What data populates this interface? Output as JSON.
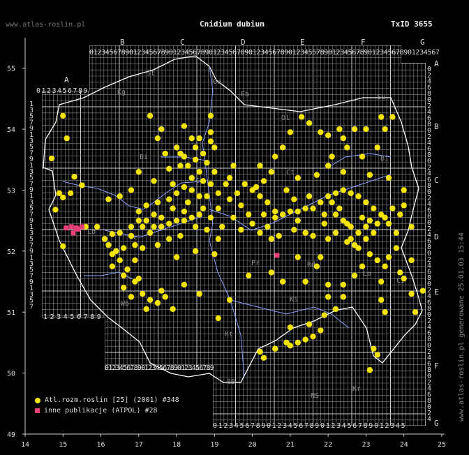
{
  "header": {
    "title": "Cnidium dubium",
    "txid": "TxID 3655",
    "site_top": "www.atlas-roslin.pl",
    "site_side": "www.atlas-roslin.pl generowane 25.01.03 15:44"
  },
  "axes": {
    "x_ticks": [
      "14",
      "15",
      "16",
      "17",
      "18",
      "19",
      "20",
      "21",
      "22",
      "23",
      "24",
      "25"
    ],
    "y_ticks": [
      "55",
      "54",
      "53",
      "52",
      "51",
      "50",
      "49"
    ]
  },
  "atpol": {
    "column_letters": [
      "A",
      "B",
      "C",
      "D",
      "E",
      "F",
      "G"
    ],
    "row_letters": [
      "A",
      "B",
      "C",
      "D",
      "E",
      "F",
      "G"
    ],
    "digits": "0123456789",
    "cells": [
      "St",
      "Kg",
      "Ga",
      "Eb",
      "Su",
      "Ol",
      "Bi",
      "Bi",
      "Ct",
      "Ce",
      "Le",
      "Lo",
      "Pr",
      "Rd",
      "Lb",
      "Ci",
      "Wb",
      "Ki",
      "Kt",
      "BB",
      "NS",
      "Kr"
    ]
  },
  "legend": {
    "items": [
      {
        "label": "Atl.rozm.roslin [25] (2001) #348",
        "color": "#f5e400",
        "shape": "circle"
      },
      {
        "label": "inne publikacje (ATPOL) #28",
        "color": "#e8417a",
        "shape": "square"
      }
    ]
  },
  "colors": {
    "background": "#000000",
    "grid": "#9a9a9a",
    "river": "#8aa0ff",
    "border": "#ffffff",
    "yellow": "#f5e400",
    "pink": "#e8417a"
  },
  "chart_data": {
    "type": "scatter",
    "xlabel": "",
    "ylabel": "",
    "xlim": [
      14,
      25
    ],
    "ylim": [
      49,
      55.5
    ],
    "series": [
      {
        "name": "Atl.rozm.roslin [25] (2001) #348",
        "color": "#f5e400",
        "points": [
          [
            15.0,
            54.22
          ],
          [
            15.1,
            53.85
          ],
          [
            14.7,
            53.52
          ],
          [
            15.3,
            53.22
          ],
          [
            15.5,
            53.08
          ],
          [
            14.9,
            52.95
          ],
          [
            15.0,
            52.88
          ],
          [
            15.2,
            52.95
          ],
          [
            14.8,
            52.68
          ],
          [
            15.0,
            52.08
          ],
          [
            16.1,
            52.2
          ],
          [
            16.3,
            52.28
          ],
          [
            16.2,
            52.1
          ],
          [
            16.5,
            52.3
          ],
          [
            16.8,
            52.4
          ],
          [
            17.0,
            52.5
          ],
          [
            17.2,
            52.5
          ],
          [
            17.1,
            52.4
          ],
          [
            17.4,
            52.4
          ],
          [
            17.6,
            52.4
          ],
          [
            17.8,
            52.45
          ],
          [
            18.0,
            52.5
          ],
          [
            18.2,
            52.5
          ],
          [
            18.4,
            52.55
          ],
          [
            18.6,
            52.6
          ],
          [
            17.0,
            52.65
          ],
          [
            17.2,
            52.75
          ],
          [
            17.5,
            52.8
          ],
          [
            17.8,
            52.85
          ],
          [
            18.0,
            52.95
          ],
          [
            18.2,
            53.05
          ],
          [
            18.4,
            53.2
          ],
          [
            18.3,
            53.4
          ],
          [
            18.5,
            53.5
          ],
          [
            18.7,
            53.6
          ],
          [
            18.5,
            53.7
          ],
          [
            18.6,
            53.85
          ],
          [
            18.9,
            53.8
          ],
          [
            18.2,
            54.05
          ],
          [
            18.0,
            53.7
          ],
          [
            17.7,
            53.6
          ],
          [
            17.5,
            53.85
          ],
          [
            17.3,
            54.22
          ],
          [
            17.6,
            54.0
          ],
          [
            18.9,
            54.22
          ],
          [
            18.9,
            53.95
          ],
          [
            18.8,
            52.9
          ],
          [
            19.1,
            52.95
          ],
          [
            19.3,
            53.1
          ],
          [
            19.1,
            52.7
          ],
          [
            19.4,
            52.85
          ],
          [
            19.6,
            52.95
          ],
          [
            19.8,
            53.1
          ],
          [
            20.0,
            53.0
          ],
          [
            20.2,
            52.9
          ],
          [
            20.4,
            52.8
          ],
          [
            20.6,
            52.65
          ],
          [
            20.8,
            52.6
          ],
          [
            21.0,
            52.65
          ],
          [
            21.2,
            52.65
          ],
          [
            21.4,
            52.7
          ],
          [
            21.6,
            52.7
          ],
          [
            21.8,
            52.8
          ],
          [
            22.0,
            52.9
          ],
          [
            22.2,
            52.95
          ],
          [
            22.4,
            53.0
          ],
          [
            22.6,
            52.95
          ],
          [
            22.8,
            52.9
          ],
          [
            23.0,
            52.8
          ],
          [
            23.2,
            52.7
          ],
          [
            23.4,
            52.6
          ],
          [
            23.6,
            52.45
          ],
          [
            23.8,
            52.3
          ],
          [
            22.2,
            52.6
          ],
          [
            22.4,
            52.5
          ],
          [
            22.6,
            52.4
          ],
          [
            22.8,
            52.3
          ],
          [
            23.0,
            52.2
          ],
          [
            23.2,
            52.3
          ],
          [
            22.0,
            52.2
          ],
          [
            22.2,
            52.3
          ],
          [
            21.6,
            52.25
          ],
          [
            21.4,
            52.3
          ],
          [
            21.2,
            52.5
          ],
          [
            20.6,
            52.55
          ],
          [
            20.4,
            52.4
          ],
          [
            20.2,
            52.3
          ],
          [
            20.5,
            52.2
          ],
          [
            16.5,
            51.85
          ],
          [
            16.7,
            51.7
          ],
          [
            16.9,
            51.5
          ],
          [
            17.1,
            51.3
          ],
          [
            17.3,
            51.2
          ],
          [
            17.5,
            51.15
          ],
          [
            17.7,
            51.25
          ],
          [
            17.2,
            51.05
          ],
          [
            16.9,
            51.85
          ],
          [
            16.6,
            51.6
          ],
          [
            19.4,
            51.2
          ],
          [
            19.1,
            50.9
          ],
          [
            20.2,
            50.35
          ],
          [
            20.3,
            50.25
          ],
          [
            20.6,
            50.4
          ],
          [
            20.9,
            50.5
          ],
          [
            21.0,
            50.45
          ],
          [
            21.2,
            50.5
          ],
          [
            21.4,
            50.55
          ],
          [
            21.6,
            50.6
          ],
          [
            21.8,
            50.7
          ],
          [
            21.5,
            50.8
          ],
          [
            21.0,
            50.75
          ],
          [
            21.9,
            50.95
          ],
          [
            22.0,
            51.25
          ],
          [
            22.4,
            51.45
          ],
          [
            22.7,
            51.6
          ],
          [
            22.9,
            51.75
          ],
          [
            23.3,
            51.85
          ],
          [
            23.6,
            51.9
          ],
          [
            23.9,
            51.65
          ],
          [
            23.4,
            51.5
          ],
          [
            23.5,
            51.0
          ],
          [
            23.4,
            51.2
          ],
          [
            24.2,
            51.3
          ],
          [
            24.3,
            51.0
          ],
          [
            24.0,
            51.55
          ],
          [
            23.1,
            50.05
          ],
          [
            23.2,
            50.4
          ],
          [
            23.3,
            50.3
          ],
          [
            22.5,
            53.7
          ],
          [
            22.9,
            53.55
          ],
          [
            23.3,
            53.7
          ],
          [
            23.5,
            54.0
          ],
          [
            23.7,
            54.2
          ],
          [
            23.4,
            54.2
          ],
          [
            23.0,
            54.0
          ],
          [
            22.7,
            54.0
          ],
          [
            22.3,
            54.0
          ],
          [
            22.0,
            53.9
          ],
          [
            21.8,
            53.95
          ],
          [
            21.5,
            54.1
          ],
          [
            21.3,
            54.2
          ],
          [
            21.0,
            53.95
          ],
          [
            20.5,
            53.3
          ],
          [
            20.2,
            53.4
          ],
          [
            21.2,
            53.2
          ],
          [
            21.7,
            53.25
          ],
          [
            22.0,
            53.4
          ],
          [
            22.4,
            53.3
          ],
          [
            23.1,
            53.25
          ],
          [
            23.6,
            53.2
          ],
          [
            24.0,
            53.0
          ],
          [
            24.0,
            52.75
          ],
          [
            23.9,
            52.6
          ],
          [
            19.9,
            52.6
          ],
          [
            19.5,
            52.55
          ],
          [
            19.2,
            52.4
          ],
          [
            19.1,
            52.2
          ],
          [
            17.5,
            52.1
          ],
          [
            17.1,
            52.05
          ],
          [
            16.6,
            52.05
          ],
          [
            16.4,
            52.0
          ],
          [
            16.3,
            51.95
          ],
          [
            18.0,
            51.9
          ],
          [
            18.5,
            52.0
          ],
          [
            19.0,
            51.95
          ],
          [
            21.2,
            51.9
          ],
          [
            21.8,
            51.9
          ],
          [
            22.5,
            52.15
          ],
          [
            22.7,
            52.1
          ],
          [
            23.1,
            51.95
          ],
          [
            23.5,
            51.75
          ],
          [
            24.2,
            51.85
          ],
          [
            24.5,
            51.35
          ],
          [
            18.1,
            53.4
          ],
          [
            17.9,
            53.1
          ],
          [
            17.8,
            53.35
          ],
          [
            18.3,
            52.8
          ],
          [
            17.4,
            53.15
          ],
          [
            17.0,
            53.3
          ],
          [
            16.8,
            53.0
          ],
          [
            16.5,
            52.9
          ],
          [
            16.2,
            52.85
          ],
          [
            15.6,
            52.4
          ],
          [
            15.9,
            52.4
          ],
          [
            16.3,
            51.75
          ],
          [
            16.6,
            51.4
          ],
          [
            16.8,
            51.25
          ],
          [
            17.0,
            51.55
          ],
          [
            17.6,
            51.35
          ],
          [
            17.9,
            51.05
          ],
          [
            18.2,
            51.45
          ],
          [
            18.6,
            51.3
          ],
          [
            19.9,
            51.6
          ],
          [
            20.5,
            51.65
          ],
          [
            20.8,
            51.5
          ],
          [
            21.4,
            51.5
          ],
          [
            22.0,
            51.45
          ],
          [
            22.2,
            51.05
          ],
          [
            22.4,
            51.25
          ],
          [
            21.7,
            51.75
          ],
          [
            23.8,
            52.05
          ],
          [
            24.2,
            52.4
          ],
          [
            22.4,
            53.85
          ],
          [
            22.1,
            53.55
          ],
          [
            20.8,
            53.7
          ],
          [
            20.6,
            53.55
          ],
          [
            19.5,
            53.4
          ],
          [
            19.0,
            53.3
          ],
          [
            18.7,
            53.15
          ],
          [
            18.6,
            52.9
          ],
          [
            18.9,
            53.1
          ],
          [
            19.4,
            53.2
          ],
          [
            20.1,
            53.05
          ],
          [
            20.3,
            53.15
          ],
          [
            20.9,
            53.0
          ],
          [
            21.1,
            52.85
          ],
          [
            21.5,
            52.9
          ],
          [
            21.9,
            52.6
          ],
          [
            22.1,
            52.8
          ],
          [
            22.3,
            52.7
          ],
          [
            22.9,
            52.55
          ],
          [
            23.1,
            52.5
          ],
          [
            23.3,
            52.45
          ],
          [
            23.5,
            52.55
          ],
          [
            23.7,
            52.7
          ],
          [
            22.6,
            52.2
          ],
          [
            22.8,
            52.05
          ],
          [
            23.0,
            52.4
          ],
          [
            22.5,
            52.45
          ],
          [
            21.9,
            52.45
          ],
          [
            21.1,
            52.35
          ],
          [
            20.7,
            52.25
          ],
          [
            20.0,
            52.45
          ],
          [
            19.7,
            52.35
          ],
          [
            18.8,
            52.35
          ],
          [
            18.5,
            52.4
          ],
          [
            18.1,
            52.25
          ],
          [
            17.8,
            52.2
          ],
          [
            17.3,
            52.3
          ],
          [
            16.8,
            52.25
          ],
          [
            16.9,
            52.1
          ],
          [
            17.4,
            52.6
          ],
          [
            17.6,
            52.55
          ],
          [
            17.9,
            52.7
          ],
          [
            18.2,
            52.65
          ],
          [
            18.7,
            52.7
          ],
          [
            18.9,
            52.55
          ],
          [
            19.7,
            52.75
          ],
          [
            20.3,
            52.6
          ],
          [
            18.4,
            53.0
          ],
          [
            18.6,
            53.3
          ],
          [
            18.2,
            53.55
          ],
          [
            18.8,
            53.45
          ],
          [
            19.0,
            53.7
          ],
          [
            18.4,
            53.85
          ],
          [
            18.1,
            53.6
          ]
        ]
      },
      {
        "name": "inne publikacje (ATPOL) #28",
        "color": "#e8417a",
        "points": [
          [
            15.08,
            52.38
          ],
          [
            15.22,
            52.4
          ],
          [
            15.35,
            52.38
          ],
          [
            15.5,
            52.4
          ],
          [
            15.27,
            52.3
          ],
          [
            15.4,
            52.36
          ],
          [
            20.65,
            51.93
          ]
        ]
      }
    ]
  }
}
